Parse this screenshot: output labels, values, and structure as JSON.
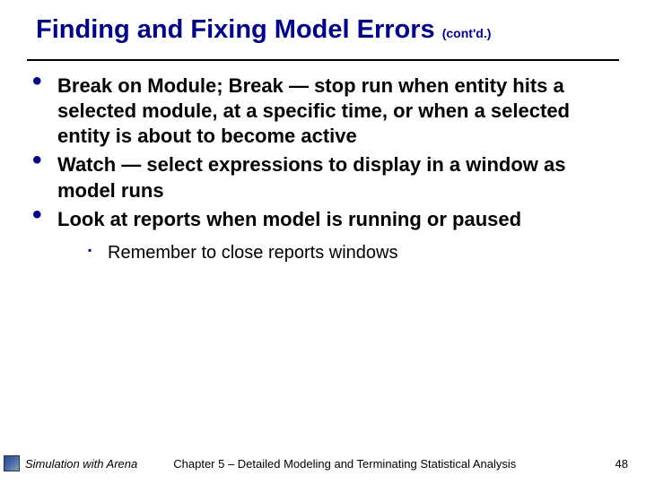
{
  "title": {
    "main": "Finding and Fixing Model Errors",
    "contd": "(cont'd.)"
  },
  "bullets": [
    "Break on Module; Break — stop run when entity hits a selected module, at a specific time, or when a selected entity is about to become active",
    "Watch — select expressions to display in a window as model runs",
    "Look at reports when model is running or paused"
  ],
  "subbullets": [
    "Remember to close reports windows"
  ],
  "footer": {
    "book": "Simulation with Arena",
    "chapter": "Chapter 5 – Detailed Modeling and Terminating Statistical Analysis",
    "page": "48"
  }
}
